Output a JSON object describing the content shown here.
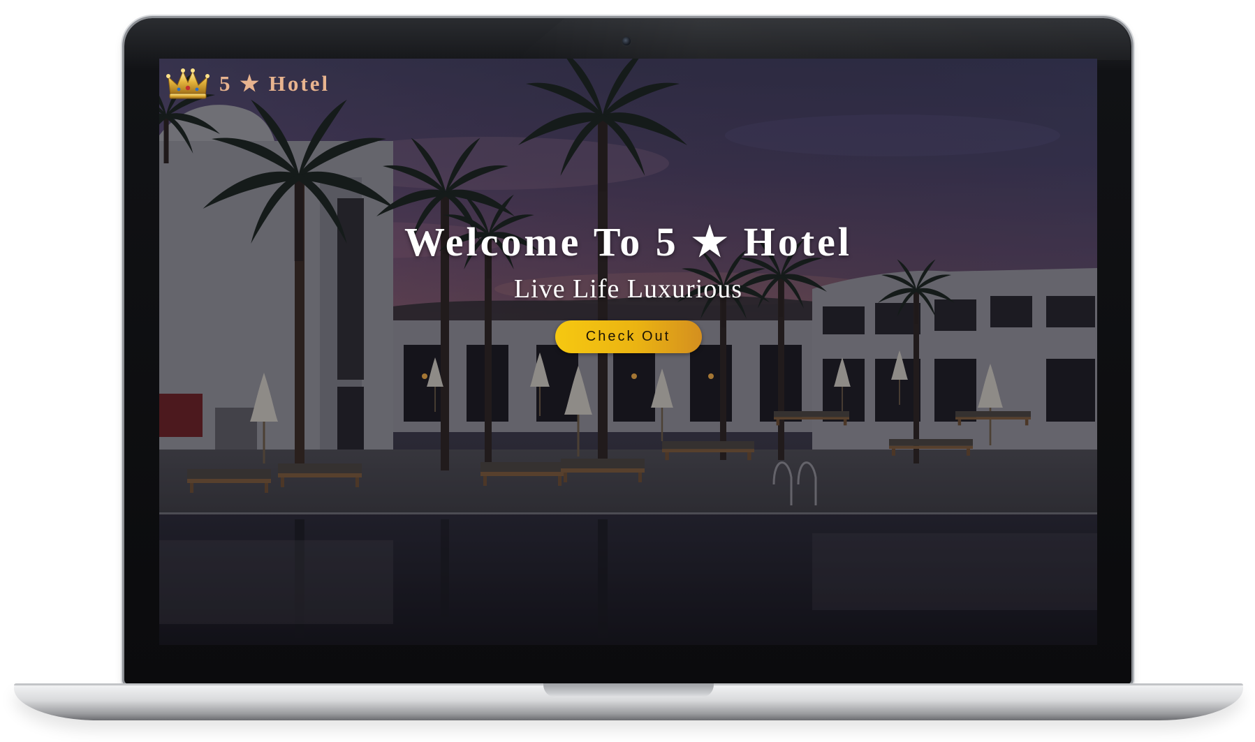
{
  "brand": {
    "name": "5 ★ Hotel",
    "icon": "crown-icon"
  },
  "hero": {
    "title": "Welcome To 5 ★ Hotel",
    "subtitle": "Live Life Luxurious",
    "cta_label": "Check Out"
  },
  "colors": {
    "brand_text": "#e8b48f",
    "cta_start": "#f6c811",
    "cta_end": "#d48f1f",
    "hero_text": "#ffffff"
  }
}
